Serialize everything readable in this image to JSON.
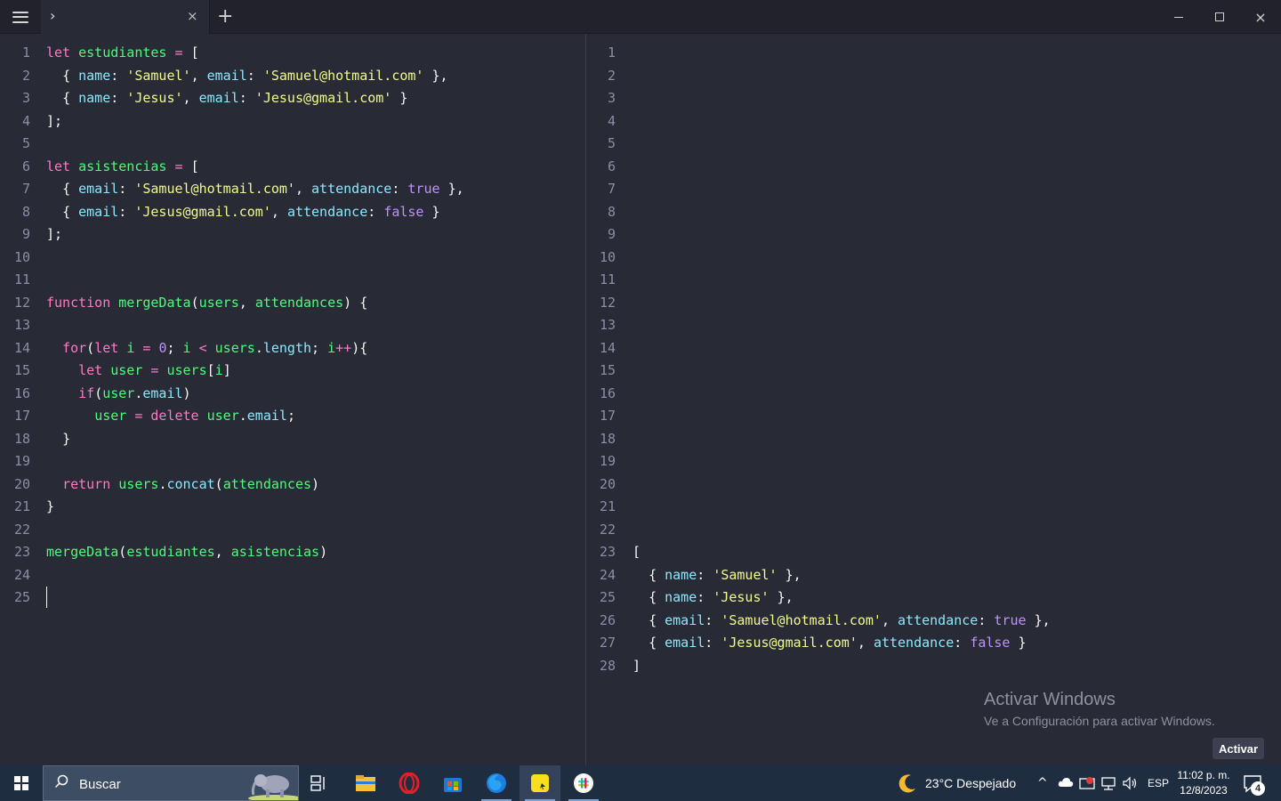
{
  "tabbar": {
    "tab_chevron": "›",
    "tab_close": "×",
    "add_tab": "+",
    "window_close": "×"
  },
  "editor": {
    "line_numbers": [
      "1",
      "2",
      "3",
      "4",
      "5",
      "6",
      "7",
      "8",
      "9",
      "10",
      "11",
      "12",
      "13",
      "14",
      "15",
      "16",
      "17",
      "18",
      "19",
      "20",
      "21",
      "22",
      "23",
      "24",
      "25"
    ],
    "lines": [
      "let estudiantes = [",
      "  { name: 'Samuel', email: 'Samuel@hotmail.com' },",
      "  { name: 'Jesus', email: 'Jesus@gmail.com' }",
      "];",
      "",
      "let asistencias = [",
      "  { email: 'Samuel@hotmail.com', attendance: true },",
      "  { email: 'Jesus@gmail.com', attendance: false }",
      "];",
      "",
      "",
      "function mergeData(users, attendances) {",
      "",
      "  for(let i = 0; i < users.length; i++){",
      "    let user = users[i]",
      "    if(user.email)",
      "      user = delete user.email;",
      "  }",
      "",
      "  return users.concat(attendances)",
      "}",
      "",
      "mergeData(estudiantes, asistencias)",
      "",
      ""
    ]
  },
  "output": {
    "line_numbers": [
      "1",
      "2",
      "3",
      "4",
      "5",
      "6",
      "7",
      "8",
      "9",
      "10",
      "11",
      "12",
      "13",
      "14",
      "15",
      "16",
      "17",
      "18",
      "19",
      "20",
      "21",
      "22",
      "23",
      "24",
      "25",
      "26",
      "27",
      "28"
    ],
    "lines": [
      "[",
      "  { name: 'Samuel' },",
      "  { name: 'Jesus' },",
      "  { email: 'Samuel@hotmail.com', attendance: true },",
      "  { email: 'Jesus@gmail.com', attendance: false }",
      "]"
    ]
  },
  "watermark": {
    "title": "Activar Windows",
    "subtitle": "Ve a Configuración para activar Windows.",
    "button": "Activar"
  },
  "taskbar": {
    "search_placeholder": "Buscar",
    "weather": "23°C  Despejado",
    "language": "ESP",
    "time": "11:02 p. m.",
    "date": "12/8/2023",
    "notification_count": "4",
    "apps": [
      "task-view-icon",
      "file-explorer-icon",
      "opera-icon",
      "microsoft-store-icon",
      "firefox-icon",
      "runjs-icon",
      "slack-icon"
    ]
  },
  "colors": {
    "background": "#282a36",
    "keyword": "#ff79c6",
    "identifier": "#50fa7b",
    "property": "#8be9fd",
    "string": "#f1fa8c",
    "boolean": "#bd93f9",
    "taskbar": "#1f2d41"
  }
}
